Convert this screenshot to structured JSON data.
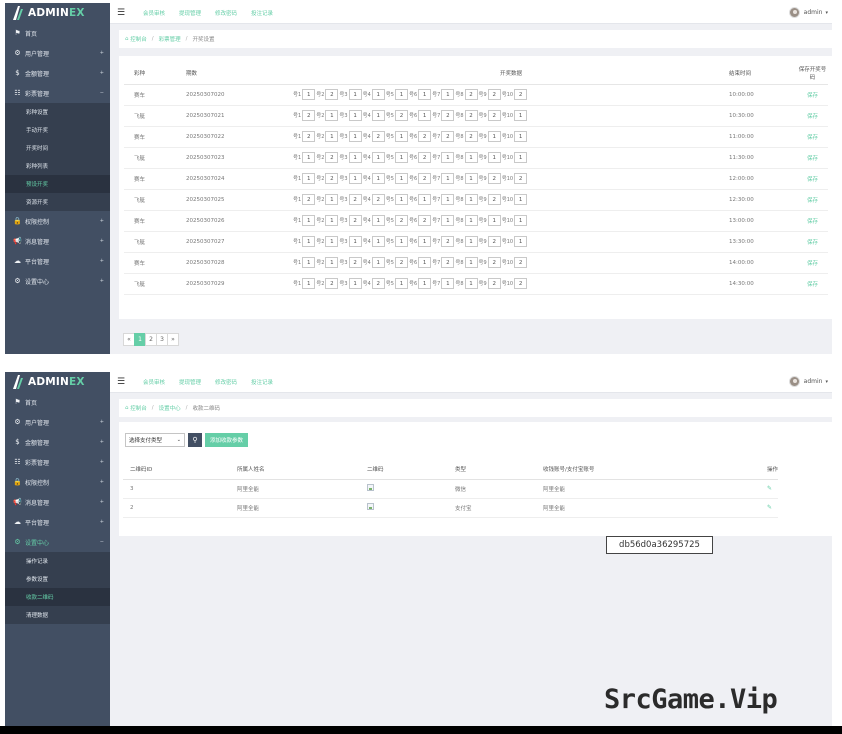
{
  "brand": {
    "part1": "ADMIN",
    "part2": "EX"
  },
  "colors": {
    "accent": "#65cea7",
    "sidebar": "#424f63",
    "sidebar_dark": "#353f4f"
  },
  "user": {
    "name": "admin"
  },
  "topnav": [
    "会员审核",
    "提现管理",
    "修改密码",
    "投注记录"
  ],
  "panel1": {
    "sidebar": [
      {
        "label": "首页",
        "icon": "flag-icon",
        "glyph": "⚑",
        "arrow": ""
      },
      {
        "label": "用户管理",
        "icon": "user-circle-icon",
        "glyph": "⚙",
        "arrow": "+"
      },
      {
        "label": "金额管理",
        "icon": "dollar-icon",
        "glyph": "$",
        "arrow": "+"
      },
      {
        "label": "彩票管理",
        "icon": "grid-icon",
        "glyph": "☷",
        "arrow": "−"
      },
      {
        "label": "权限控制",
        "icon": "lock-icon",
        "glyph": "🔒",
        "arrow": "+"
      },
      {
        "label": "消息管理",
        "icon": "megaphone-icon",
        "glyph": "📢",
        "arrow": "+"
      },
      {
        "label": "平台管理",
        "icon": "cloud-icon",
        "glyph": "☁",
        "arrow": "+"
      },
      {
        "label": "设置中心",
        "icon": "gear-icon",
        "glyph": "⚙",
        "arrow": "+"
      }
    ],
    "submenu": [
      "彩种设置",
      "手动开奖",
      "开奖时间",
      "彩种列表",
      "预设开奖",
      "资源开奖"
    ],
    "submenu_active": 4,
    "breadcrumb": [
      "控制台",
      "彩票管理",
      "开奖设置"
    ],
    "table_headers": {
      "type": "彩种",
      "issue": "期数",
      "nums": "开奖数据",
      "time": "结束时间",
      "save": "保存开奖号码"
    },
    "slot_prefix": "号",
    "save_label": "保存",
    "rows": [
      {
        "type": "赛车",
        "issue": "20250307020",
        "nums": [
          1,
          2,
          1,
          1,
          1,
          1,
          1,
          2,
          2,
          2
        ],
        "time": "10:00:00"
      },
      {
        "type": "飞艇",
        "issue": "20250307021",
        "nums": [
          2,
          1,
          1,
          1,
          2,
          1,
          2,
          2,
          2,
          1
        ],
        "time": "10:30:00"
      },
      {
        "type": "赛车",
        "issue": "20250307022",
        "nums": [
          2,
          1,
          1,
          2,
          1,
          2,
          2,
          2,
          1,
          1
        ],
        "time": "11:00:00"
      },
      {
        "type": "飞艇",
        "issue": "20250307023",
        "nums": [
          1,
          2,
          1,
          1,
          1,
          2,
          1,
          1,
          1,
          1
        ],
        "time": "11:30:00"
      },
      {
        "type": "赛车",
        "issue": "20250307024",
        "nums": [
          1,
          2,
          1,
          1,
          1,
          2,
          1,
          1,
          2,
          2
        ],
        "time": "12:00:00"
      },
      {
        "type": "飞艇",
        "issue": "20250307025",
        "nums": [
          2,
          1,
          2,
          2,
          1,
          1,
          1,
          1,
          2,
          1
        ],
        "time": "12:30:00"
      },
      {
        "type": "赛车",
        "issue": "20250307026",
        "nums": [
          1,
          1,
          2,
          1,
          2,
          2,
          1,
          1,
          1,
          1
        ],
        "time": "13:00:00"
      },
      {
        "type": "飞艇",
        "issue": "20250307027",
        "nums": [
          1,
          1,
          1,
          1,
          1,
          1,
          2,
          1,
          2,
          1
        ],
        "time": "13:30:00"
      },
      {
        "type": "赛车",
        "issue": "20250307028",
        "nums": [
          1,
          1,
          2,
          1,
          2,
          1,
          2,
          1,
          2,
          2
        ],
        "time": "14:00:00"
      },
      {
        "type": "飞艇",
        "issue": "20250307029",
        "nums": [
          1,
          2,
          1,
          2,
          1,
          1,
          1,
          1,
          2,
          2
        ],
        "time": "14:30:00"
      }
    ],
    "pager": [
      "«",
      "1",
      "2",
      "3",
      "»"
    ],
    "pager_current": 1
  },
  "panel2": {
    "sidebar": [
      {
        "label": "首页",
        "icon": "flag-icon",
        "glyph": "⚑",
        "arrow": ""
      },
      {
        "label": "用户管理",
        "icon": "user-circle-icon",
        "glyph": "⚙",
        "arrow": "+"
      },
      {
        "label": "金额管理",
        "icon": "dollar-icon",
        "glyph": "$",
        "arrow": "+"
      },
      {
        "label": "彩票管理",
        "icon": "grid-icon",
        "glyph": "☷",
        "arrow": "+"
      },
      {
        "label": "权限控制",
        "icon": "lock-icon",
        "glyph": "🔒",
        "arrow": "+"
      },
      {
        "label": "消息管理",
        "icon": "megaphone-icon",
        "glyph": "📢",
        "arrow": "+"
      },
      {
        "label": "平台管理",
        "icon": "cloud-icon",
        "glyph": "☁",
        "arrow": "+"
      },
      {
        "label": "设置中心",
        "icon": "gear-icon",
        "glyph": "⚙",
        "arrow": "−"
      }
    ],
    "open_index": 7,
    "submenu": [
      "操作记录",
      "参数设置",
      "收款二维码",
      "清理数据"
    ],
    "submenu_active": 2,
    "breadcrumb": [
      "控制台",
      "设置中心",
      "收款二维码"
    ],
    "select_label": "选择支付类型",
    "add_label": "添加收款参数",
    "table_headers": [
      "二维码ID",
      "所属人姓名",
      "二维码",
      "类型",
      "收钱账号/支付宝账号",
      "操作"
    ],
    "rows": [
      {
        "id": "3",
        "name": "阿里全能",
        "type": "微信",
        "account": "阿里全能"
      },
      {
        "id": "2",
        "name": "阿里全能",
        "type": "支付宝",
        "account": "阿里全能"
      }
    ]
  },
  "tooltip": "db56d0a36295725",
  "watermark": "SrcGame.Vip"
}
